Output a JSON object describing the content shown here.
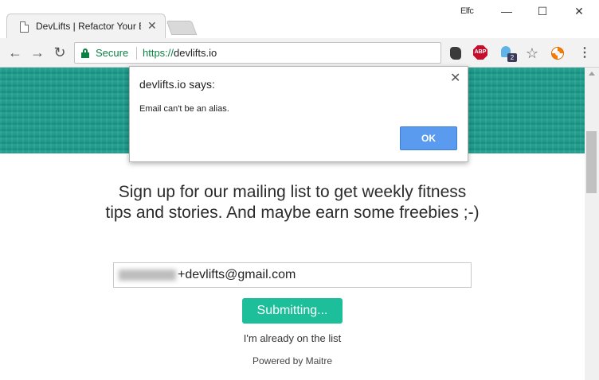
{
  "browser": {
    "tab_title": "DevLifts | Refactor Your B",
    "profile_label": "Elfc",
    "secure_label": "Secure",
    "url_scheme": "https://",
    "url_host": "devlifts.io"
  },
  "extensions": {
    "abp_label": "ABP",
    "ghost_badge": "2"
  },
  "dialog": {
    "title": "devlifts.io says:",
    "message": "Email can't be an alias.",
    "ok_label": "OK"
  },
  "page": {
    "signup_heading": "Sign up for our mailing list to get weekly fitness tips and stories. And maybe earn some freebies ;-)",
    "email_value_visible": "+devlifts@gmail.com",
    "submit_label": "Submitting...",
    "already_link": "I'm already on the list",
    "powered_by": "Powered by Maitre"
  },
  "colors": {
    "hero": "#1f9e8e",
    "submit_button": "#1dbf9b",
    "ok_button": "#5a9bf0",
    "secure_green": "#0b8043"
  },
  "icons": [
    "document-icon",
    "tab-close-icon",
    "back-icon",
    "forward-icon",
    "reload-icon",
    "lock-icon",
    "evernote-icon",
    "abp-icon",
    "ghostery-icon",
    "star-icon",
    "lifebuoy-icon",
    "menu-icon",
    "minimize-icon",
    "maximize-icon",
    "window-close-icon",
    "dialog-close-icon"
  ]
}
